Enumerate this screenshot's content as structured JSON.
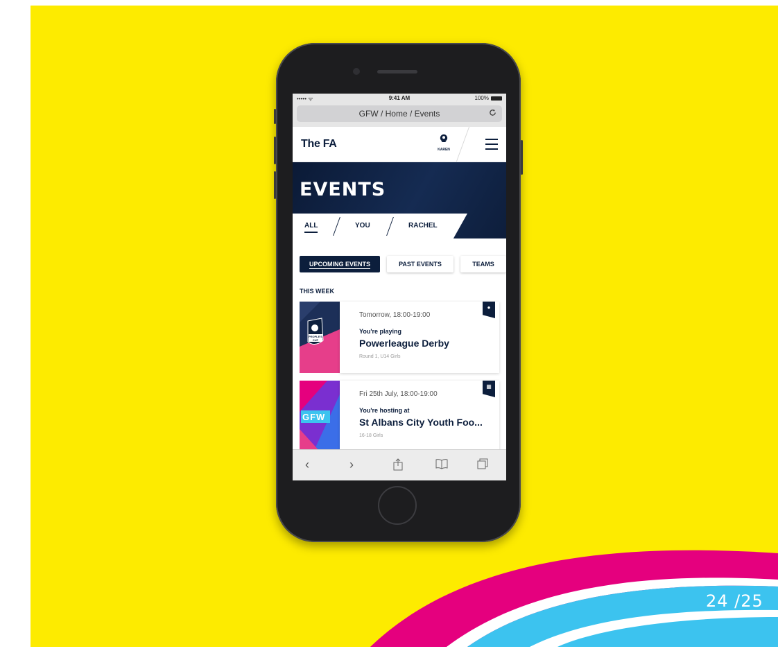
{
  "slide": {
    "page_number": "24 /25",
    "colors": {
      "background": "#fdeb00",
      "magenta": "#e5007e",
      "cyan": "#3cc3ef"
    }
  },
  "phone": {
    "status_bar": {
      "signal": "••••• ᯤ",
      "time": "9:41 AM",
      "battery": "100%"
    },
    "url_bar": {
      "text": "GFW / Home / Events",
      "reload_icon": "reload-icon"
    },
    "header": {
      "logo": "The FA",
      "user_label": "KAREN",
      "menu_icon": "hamburger-icon"
    },
    "hero": {
      "title": "EVENTS",
      "tabs": [
        {
          "label": "ALL",
          "active": true
        },
        {
          "label": "YOU",
          "active": false
        },
        {
          "label": "RACHEL",
          "active": false
        }
      ]
    },
    "filters": [
      {
        "label": "UPCOMING EVENTS",
        "active": true
      },
      {
        "label": "PAST EVENTS",
        "active": false
      },
      {
        "label": "TEAMS",
        "active": false
      }
    ],
    "section_title": "THIS WEEK",
    "events": [
      {
        "time": "Tomorrow, 18:00-19:00",
        "role": "You're playing",
        "name": "Powerleague Derby",
        "meta": "Round 1, U14 Girls",
        "badge_text": "PEOPLE'S CUP",
        "flag_icon": "football-icon"
      },
      {
        "time": "Fri 25th July, 18:00-19:00",
        "role": "You're hosting at",
        "name": "St Albans City Youth Foo...",
        "meta": "16-18 Girls",
        "badge_text": "GFW",
        "flag_icon": "calendar-icon"
      }
    ],
    "browser_toolbar": {
      "icons": [
        "back-icon",
        "forward-icon",
        "share-icon",
        "bookmarks-icon",
        "tabs-icon"
      ]
    }
  }
}
